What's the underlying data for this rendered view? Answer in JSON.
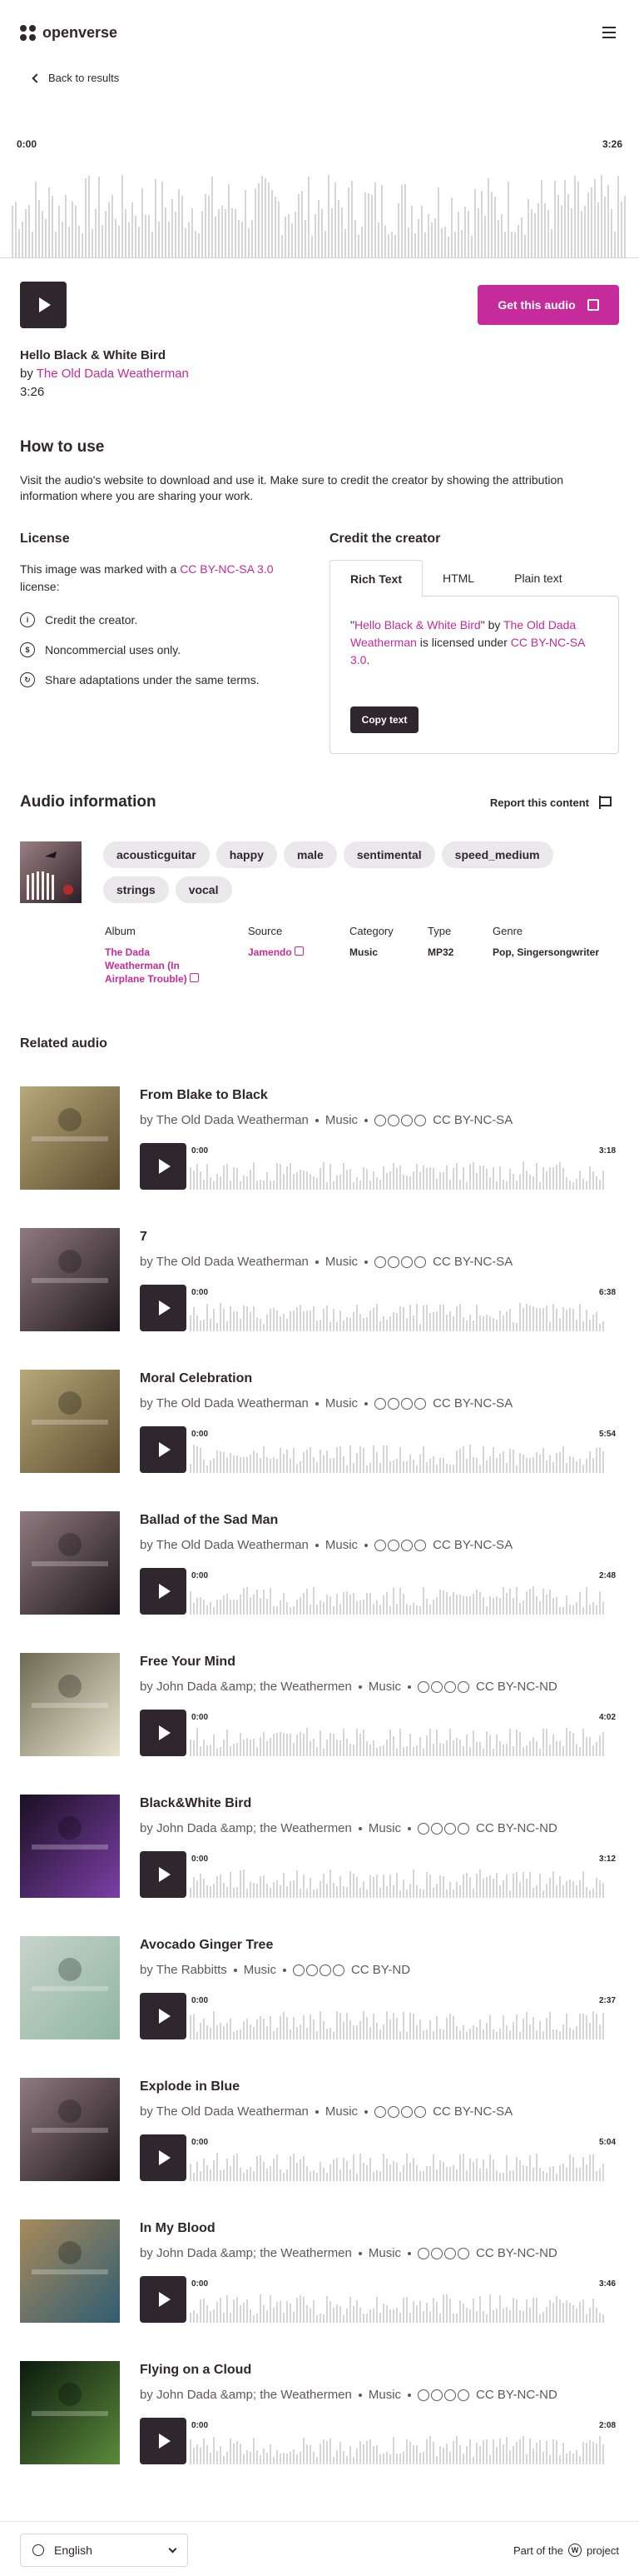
{
  "header": {
    "brand": "openverse",
    "menu_icon": "hamburger-menu-icon"
  },
  "back_link": "Back to results",
  "player": {
    "current_time": "0:00",
    "duration": "3:26",
    "get_button": "Get this audio"
  },
  "track": {
    "title": "Hello Black & White Bird",
    "by_prefix": "by",
    "creator": "The Old Dada Weatherman",
    "length": "3:26"
  },
  "how_to_use": {
    "heading": "How to use",
    "text": "Visit the audio's website to download and use it. Make sure to credit the creator by showing the attribution information where you are sharing your work."
  },
  "license": {
    "heading": "License",
    "text_before": "This image was marked with a ",
    "link": "CC BY-NC-SA 3.0",
    "text_after": " license:",
    "items": [
      "Credit the creator.",
      "Noncommercial uses only.",
      "Share adaptations under the same terms."
    ]
  },
  "credit": {
    "heading": "Credit the creator",
    "tabs": [
      "Rich Text",
      "HTML",
      "Plain text"
    ],
    "quote_open": "\"",
    "title": "Hello Black & White Bird",
    "quote_close": "\"",
    "by": " by ",
    "creator": "The Old Dada Weatherman",
    "licensed": " is licensed under ",
    "license": "CC BY-NC-SA 3.0",
    "period": ".",
    "copy_button": "Copy text"
  },
  "audio_info": {
    "heading": "Audio information",
    "report": "Report this content",
    "tags": [
      "acousticguitar",
      "happy",
      "male",
      "sentimental",
      "speed_medium",
      "strings",
      "vocal"
    ],
    "meta": {
      "album_label": "Album",
      "album_value": "The Dada Weatherman (In Airplane Trouble)",
      "source_label": "Source",
      "source_value": "Jamendo",
      "category_label": "Category",
      "category_value": "Music",
      "type_label": "Type",
      "type_value": "MP32",
      "genre_label": "Genre",
      "genre_value": "Pop, Singersongwriter"
    }
  },
  "related": {
    "heading": "Related audio",
    "items": [
      {
        "title": "From Blake to Black",
        "creator": "by The Old Dada Weatherman",
        "category": "Music",
        "license": "CC BY-NC-SA",
        "start": "0:00",
        "duration": "3:18"
      },
      {
        "title": "7",
        "creator": "by The Old Dada Weatherman",
        "category": "Music",
        "license": "CC BY-NC-SA",
        "start": "0:00",
        "duration": "6:38"
      },
      {
        "title": "Moral Celebration",
        "creator": "by The Old Dada Weatherman",
        "category": "Music",
        "license": "CC BY-NC-SA",
        "start": "0:00",
        "duration": "5:54"
      },
      {
        "title": "Ballad of the Sad Man",
        "creator": "by The Old Dada Weatherman",
        "category": "Music",
        "license": "CC BY-NC-SA",
        "start": "0:00",
        "duration": "2:48"
      },
      {
        "title": "Free Your Mind",
        "creator": "by John Dada &amp; the Weathermen",
        "category": "Music",
        "license": "CC BY-NC-ND",
        "start": "0:00",
        "duration": "4:02"
      },
      {
        "title": "Black&White Bird",
        "creator": "by John Dada &amp; the Weathermen",
        "category": "Music",
        "license": "CC BY-NC-ND",
        "start": "0:00",
        "duration": "3:12"
      },
      {
        "title": "Avocado Ginger Tree",
        "creator": "by The Rabbitts",
        "category": "Music",
        "license": "CC BY-ND",
        "start": "0:00",
        "duration": "2:37"
      },
      {
        "title": "Explode in Blue",
        "creator": "by The Old Dada Weatherman",
        "category": "Music",
        "license": "CC BY-NC-SA",
        "start": "0:00",
        "duration": "5:04"
      },
      {
        "title": "In My Blood",
        "creator": "by John Dada &amp; the Weathermen",
        "category": "Music",
        "license": "CC BY-NC-ND",
        "start": "0:00",
        "duration": "3:46"
      },
      {
        "title": "Flying on a Cloud",
        "creator": "by John Dada &amp; the Weathermen",
        "category": "Music",
        "license": "CC BY-NC-ND",
        "start": "0:00",
        "duration": "2:08"
      }
    ]
  },
  "footer": {
    "language": "English",
    "part_of_before": "Part of the",
    "part_of_after": "project"
  },
  "colors": {
    "accent": "#c52b9b",
    "ink": "#30272e",
    "muted": "#60575e",
    "tag_bg": "#ebe8eb"
  }
}
